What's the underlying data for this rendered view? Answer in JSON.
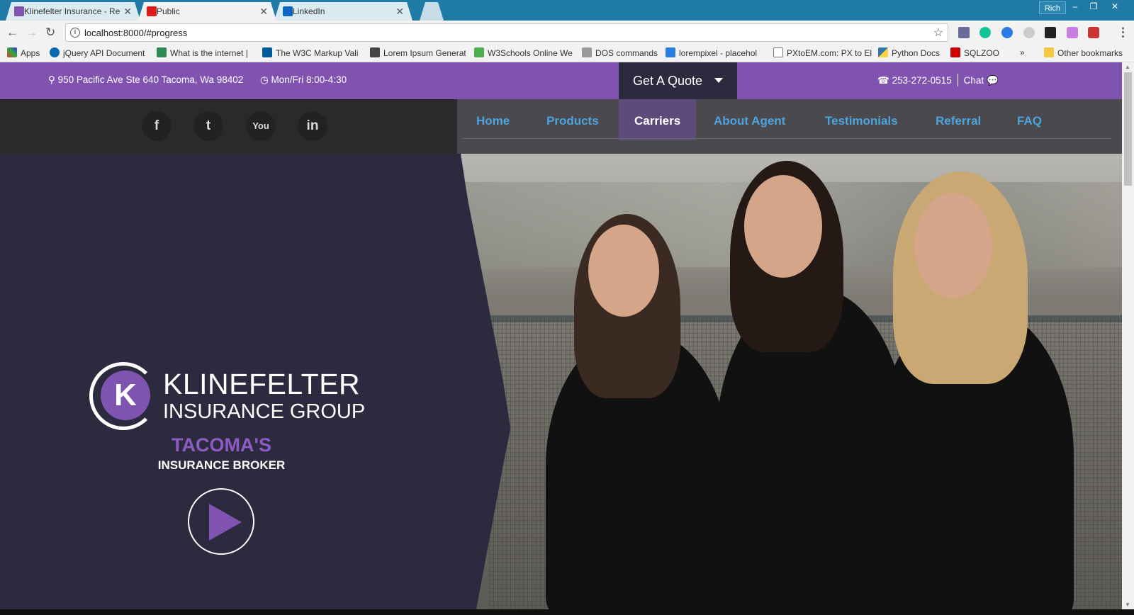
{
  "browser": {
    "tabs": [
      {
        "title": "Klinefelter Insurance - Re",
        "favicon": "k-logo-icon",
        "color": "#8053b0"
      },
      {
        "title": "Public",
        "favicon": "angular-icon",
        "color": "#dd1b16"
      },
      {
        "title": "LinkedIn",
        "favicon": "linkedin-icon",
        "color": "#0a66c2"
      }
    ],
    "user": "Rich",
    "url": "localhost:8000/#progress",
    "bookmarks": [
      "Apps",
      "jQuery API Document",
      "What is the internet |",
      "The W3C Markup Vali",
      "Lorem Ipsum Generat",
      "W3Schools Online We",
      "DOS commands",
      "lorempixel - placehol",
      "PXtoEM.com: PX to El",
      "Python Docs",
      "SQLZOO",
      "»",
      "Other bookmarks"
    ]
  },
  "topbar": {
    "address": "950 Pacific Ave Ste 640 Tacoma, Wa 98402",
    "hours": "Mon/Fri 8:00-4:30",
    "quote_label": "Get A Quote",
    "phone": "253-272-0515",
    "chat": "Chat"
  },
  "social": [
    "facebook-icon",
    "twitter-icon",
    "youtube-icon",
    "linkedin-icon"
  ],
  "nav": {
    "items": [
      "Home",
      "Products",
      "Carriers",
      "About Agent",
      "Testimonials",
      "Referral",
      "FAQ"
    ],
    "active": "Carriers",
    "link_color": "#4da3dc"
  },
  "hero": {
    "logo_line1": "KLINEFELTER",
    "logo_line2": "INSURANCE GROUP",
    "logo_letter": "K",
    "tagline1": "TACOMA'S",
    "tagline2": "INSURANCE BROKER",
    "accent": "#8053b0"
  }
}
